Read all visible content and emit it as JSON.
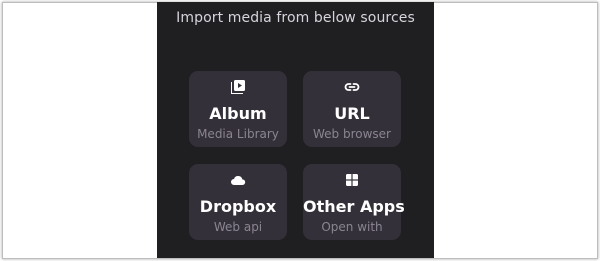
{
  "heading": "Import media from below sources",
  "sources": [
    {
      "title": "Album",
      "subtitle": "Media Library",
      "icon": "media-library-icon"
    },
    {
      "title": "URL",
      "subtitle": "Web browser",
      "icon": "link-icon"
    },
    {
      "title": "Dropbox",
      "subtitle": "Web api",
      "icon": "cloud-icon"
    },
    {
      "title": "Other Apps",
      "subtitle": "Open with",
      "icon": "apps-grid-icon"
    }
  ],
  "colors": {
    "page_background": "#ffffff",
    "screen_background": "#1f1e21",
    "card_background": "#343039",
    "title_text": "#ffffff",
    "subtitle_text": "#8a8591",
    "heading_text": "#d7d4db"
  }
}
